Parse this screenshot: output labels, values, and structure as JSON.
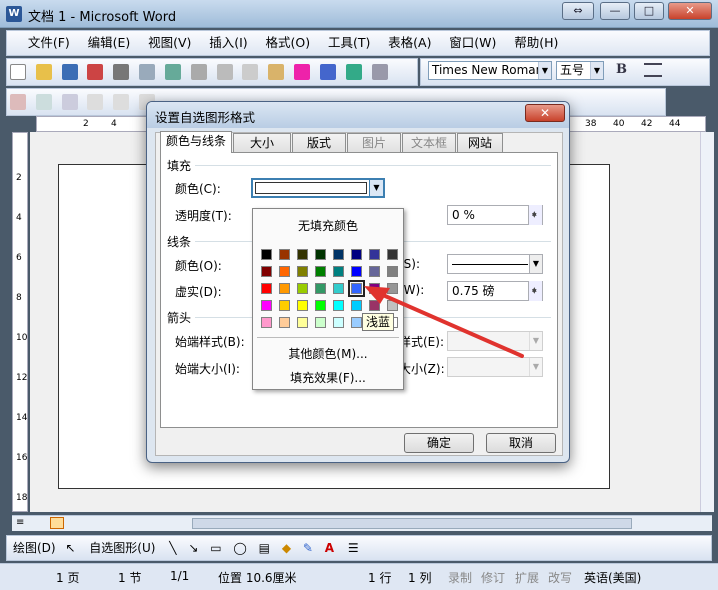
{
  "window": {
    "title": "文档 1 - Microsoft Word",
    "icon": "word-app-icon",
    "buttons": [
      "⇔",
      "—",
      "□",
      "✕"
    ]
  },
  "menu": [
    "文件(F)",
    "编辑(E)",
    "视图(V)",
    "插入(I)",
    "格式(O)",
    "工具(T)",
    "表格(A)",
    "窗口(W)",
    "帮助(H)"
  ],
  "format_toolbar": {
    "font": "Times New Roman",
    "size": "五号",
    "bold": "B"
  },
  "ruler": {
    "left_ticks": [
      "2",
      "4"
    ],
    "right_ticks": [
      "38",
      "40",
      "42",
      "44"
    ]
  },
  "vruler": [
    "2",
    "4",
    "6",
    "8",
    "10",
    "12",
    "14",
    "16",
    "18"
  ],
  "dialog": {
    "title": "设置自选图形格式",
    "close_label": "✕",
    "tabs": [
      {
        "label": "颜色与线条",
        "state": "active"
      },
      {
        "label": "大小",
        "state": "normal"
      },
      {
        "label": "版式",
        "state": "normal"
      },
      {
        "label": "图片",
        "state": "disabled"
      },
      {
        "label": "文本框",
        "state": "disabled"
      },
      {
        "label": "网站",
        "state": "normal"
      }
    ],
    "fill": {
      "section": "填充",
      "color_label": "颜色(C):",
      "transparency_label": "透明度(T):",
      "transparency_value": "0 %"
    },
    "line": {
      "section": "线条",
      "color_label": "颜色(O):",
      "dash_label": "虚实(D):",
      "style_label": "(S):",
      "weight_label": "(W):",
      "weight_value": "0.75 磅"
    },
    "arrows": {
      "section": "箭头",
      "begin_style_label": "始端样式(B):",
      "begin_size_label": "始端大小(I):",
      "end_style_label": "样式(E):",
      "end_size_label": "大小(Z):"
    },
    "ok_label": "确定",
    "cancel_label": "取消"
  },
  "palette": {
    "no_fill": "无填充颜色",
    "more_colors": "其他颜色(M)...",
    "fill_effects": "填充效果(F)...",
    "tooltip": "浅蓝",
    "selected": "#3366FF",
    "colors": [
      [
        "#000000",
        "#993300",
        "#333300",
        "#003300",
        "#003366",
        "#000080",
        "#333399",
        "#333333"
      ],
      [
        "#800000",
        "#FF6600",
        "#808000",
        "#008000",
        "#008080",
        "#0000FF",
        "#666699",
        "#808080"
      ],
      [
        "#FF0000",
        "#FF9900",
        "#99CC00",
        "#339966",
        "#33CCCC",
        "#3366FF",
        "#800080",
        "#969696"
      ],
      [
        "#FF00FF",
        "#FFCC00",
        "#FFFF00",
        "#00FF00",
        "#00FFFF",
        "#00CCFF",
        "#993366",
        "#C0C0C0"
      ],
      [
        "#FF99CC",
        "#FFCC99",
        "#FFFF99",
        "#CCFFCC",
        "#CCFFFF",
        "#99CCFF",
        "#CC99FF",
        "#FFFFFF"
      ]
    ]
  },
  "drawbar": {
    "draw": "绘图(D)",
    "autoshapes": "自选图形(U)"
  },
  "status": {
    "page": "1 页",
    "section": "1 节",
    "pages": "1/1",
    "position": "位置 10.6厘米",
    "line": "1 行",
    "column": "1 列",
    "rec": "录制",
    "trk": "修订",
    "ext": "扩展",
    "ovr": "改写",
    "language": "英语(美国)"
  },
  "colors": {
    "arrow": "#E0332E",
    "accent": "#2b5797"
  }
}
